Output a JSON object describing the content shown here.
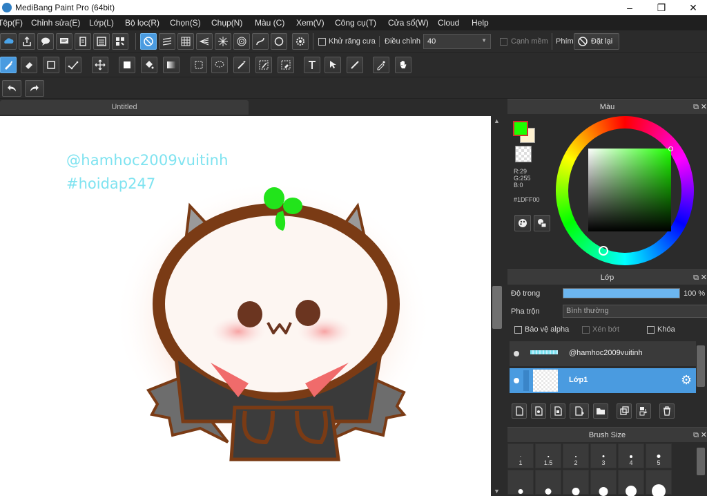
{
  "window": {
    "title": "MediBang Paint Pro (64bit)",
    "minimize": "–",
    "maximize": "❐",
    "close": "✕"
  },
  "menu": [
    "Tệp(F)",
    "Chỉnh sửa(E)",
    "Lớp(L)",
    "Bộ lọc(R)",
    "Chọn(S)",
    "Chụp(N)",
    "Màu (C)",
    "Xem(V)",
    "Công cụ(T)",
    "Cửa sổ(W)",
    "Cloud",
    "Help"
  ],
  "toolbar1": {
    "antialias_label": "Khử răng cưa",
    "adjust_label": "Điều chỉnh",
    "adjust_value": "40",
    "soft_edge_label": "Cạnh mềm",
    "key_label": "Phím",
    "reset_label": "Đặt lại"
  },
  "document": {
    "tab": "Untitled",
    "text_line1": "@hamhoc2009vuitinh",
    "text_line2": "#hoidap247"
  },
  "color_panel": {
    "title": "Màu",
    "r": "R:29",
    "g": "G:255",
    "b": "B:0",
    "hex": "#1DFF00",
    "primary_color": "#1DFF00",
    "secondary_color": "#ffffff",
    "dock": "⧉",
    "close": "✕"
  },
  "layer_panel": {
    "title": "Lớp",
    "opacity_label": "Độ trong",
    "opacity_value": "100 %",
    "opacity": 1.0,
    "blend_label": "Pha trộn",
    "blend_value": "Bình thường",
    "protect_alpha": "Bảo vệ alpha",
    "clipping": "Xén bớt",
    "lock": "Khóa",
    "layers": [
      {
        "name": "@hamhoc2009vuitinh",
        "selected": false
      },
      {
        "name": "Lớp1",
        "selected": true
      }
    ],
    "dock": "⧉",
    "close": "✕"
  },
  "brush_size_panel": {
    "title": "Brush Size",
    "sizes": [
      "1",
      "1.5",
      "2",
      "3",
      "4",
      "5"
    ],
    "dock": "⧉",
    "close": "✕"
  },
  "accent_color": "#4a9be0"
}
